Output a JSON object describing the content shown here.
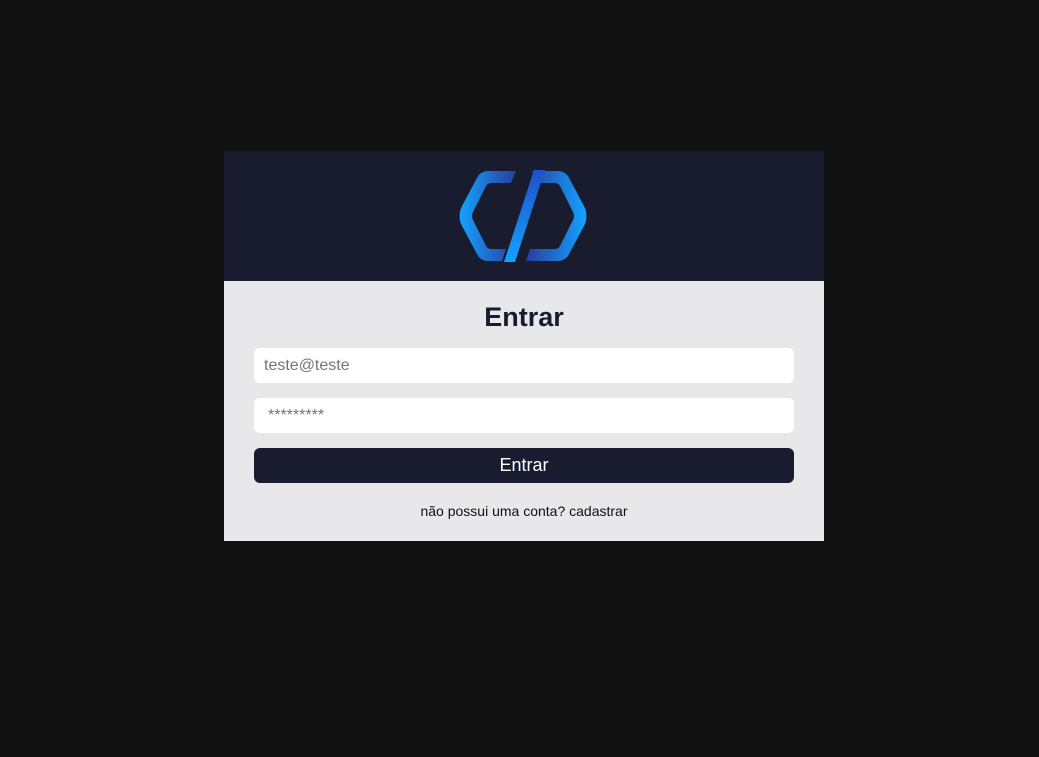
{
  "colors": {
    "page_background": "#121212",
    "card_background": "#e8e8ea",
    "header_background": "#191c2f",
    "accent_start": "#2a3d9e",
    "accent_end": "#13a3ff"
  },
  "header": {
    "logo_icon": "code-slash-logo-icon"
  },
  "form": {
    "title": "Entrar",
    "email_placeholder": "teste@teste",
    "password_placeholder": "*********",
    "submit_label": "Entrar"
  },
  "footer": {
    "prompt_text": "não possui uma conta?",
    "signup_link": "cadastrar"
  }
}
